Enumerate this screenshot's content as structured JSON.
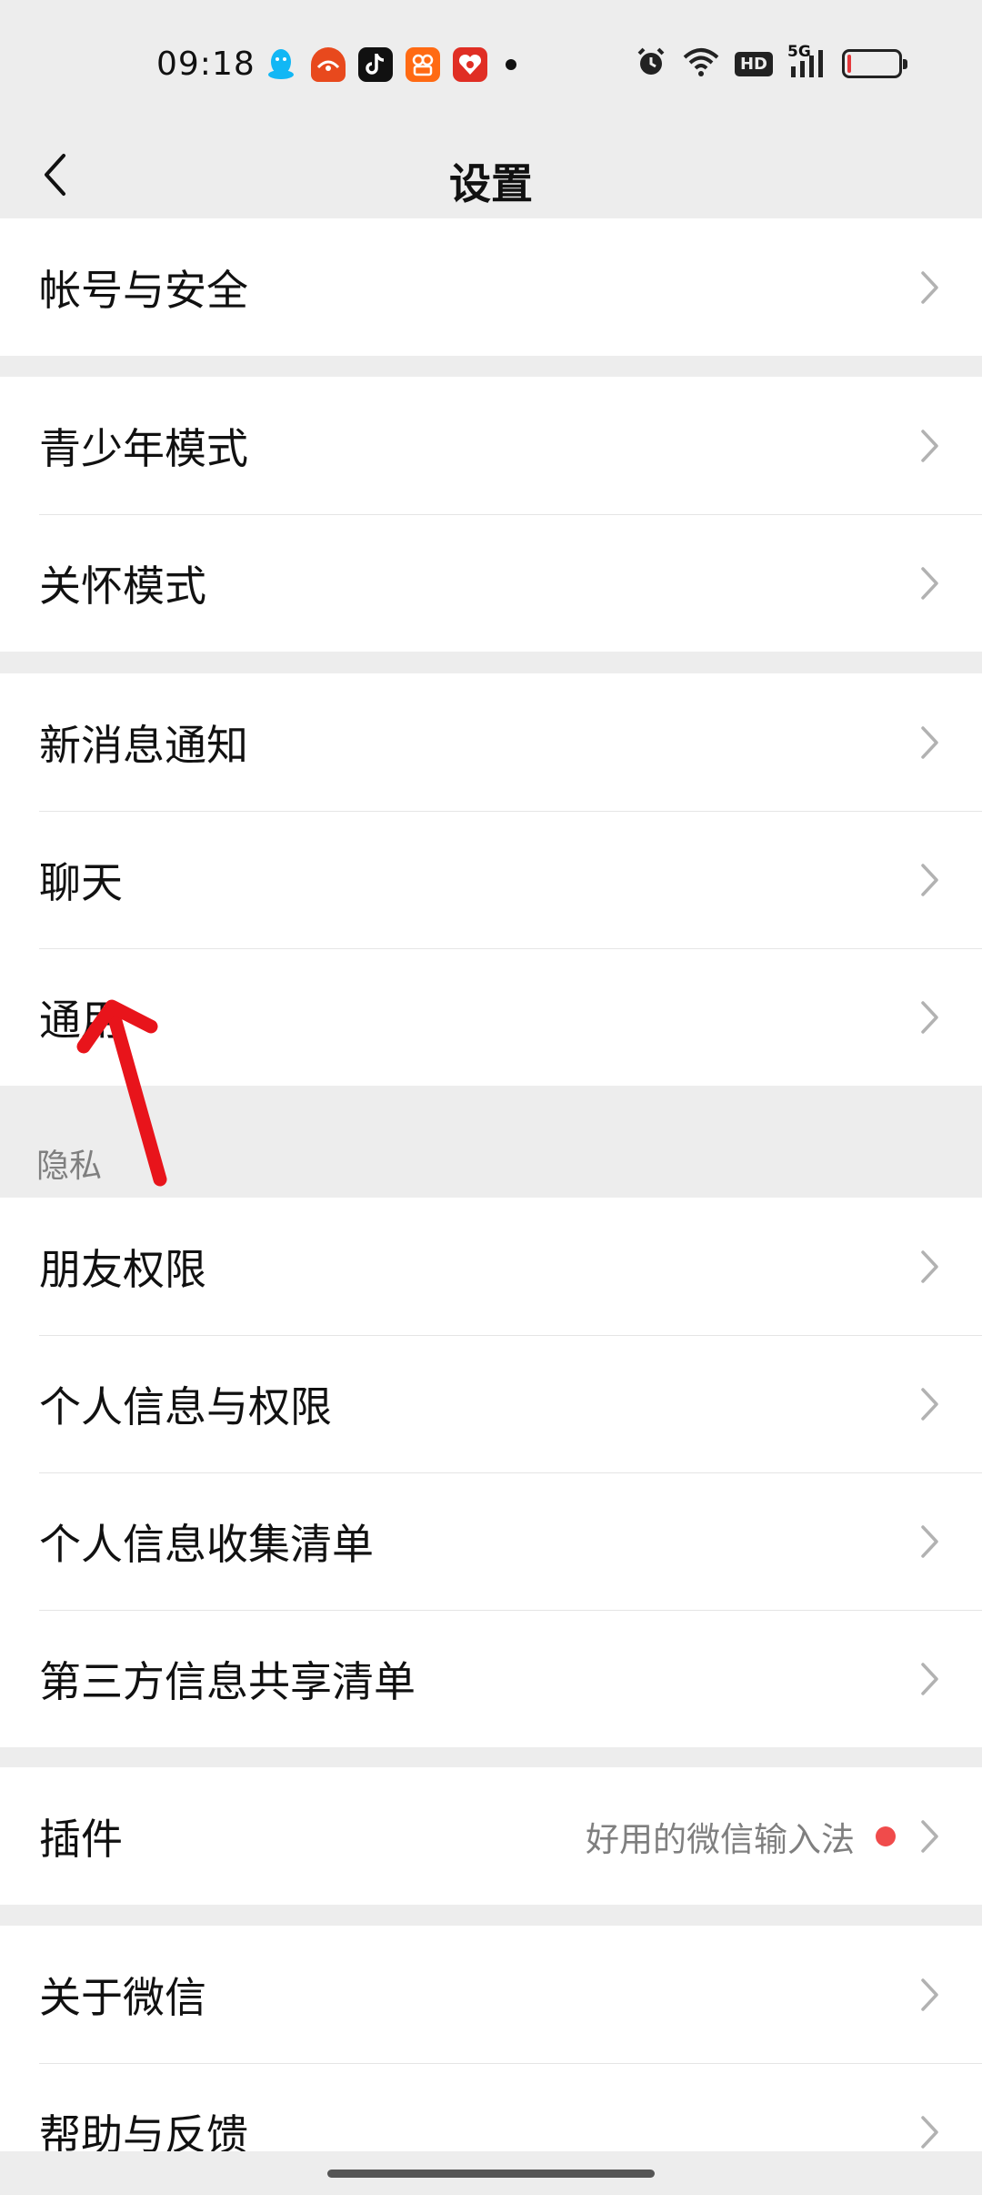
{
  "status_bar": {
    "time": "09:18",
    "network": "5G",
    "hd": "HD",
    "battery_level": 0.08,
    "notification_icons": [
      "qq-icon",
      "taobao-icon",
      "douyin-icon",
      "kuaishou-icon",
      "pinduoduo-icon"
    ]
  },
  "nav": {
    "title": "设置",
    "back_icon": "chevron-left-icon"
  },
  "groups": [
    {
      "items": [
        {
          "label": "帐号与安全"
        }
      ]
    },
    {
      "items": [
        {
          "label": "青少年模式"
        },
        {
          "label": "关怀模式"
        }
      ]
    },
    {
      "items": [
        {
          "label": "新消息通知"
        },
        {
          "label": "聊天"
        },
        {
          "label": "通用"
        }
      ]
    },
    {
      "header": "隐私",
      "items": [
        {
          "label": "朋友权限"
        },
        {
          "label": "个人信息与权限"
        },
        {
          "label": "个人信息收集清单"
        },
        {
          "label": "第三方信息共享清单"
        }
      ]
    },
    {
      "items": [
        {
          "label": "插件",
          "value": "好用的微信输入法",
          "badge_color": "#f04b4b"
        }
      ]
    },
    {
      "items": [
        {
          "label": "关于微信"
        },
        {
          "label": "帮助与反馈"
        }
      ]
    }
  ],
  "colors": {
    "background": "#ededed",
    "annotation_arrow": "#e8141b"
  }
}
